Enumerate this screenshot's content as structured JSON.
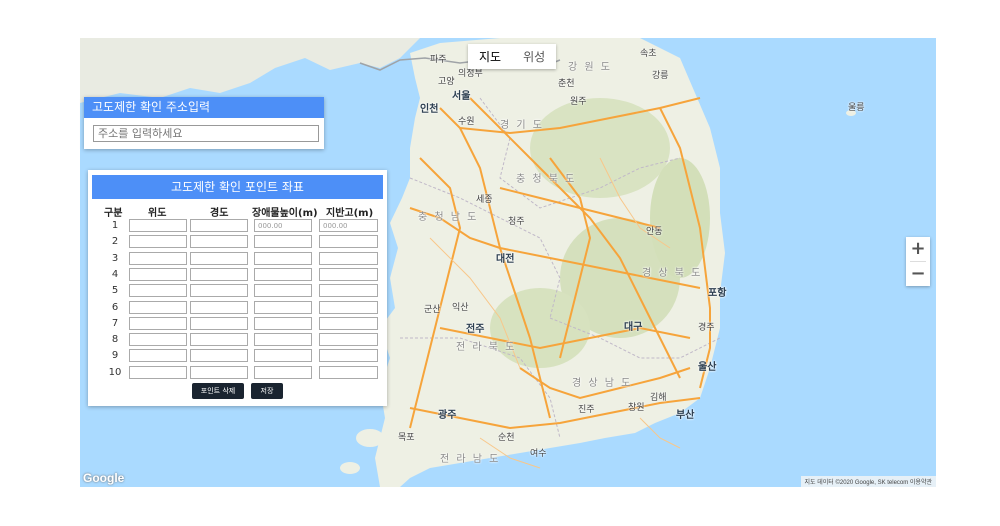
{
  "map": {
    "type_tabs": [
      {
        "label": "지도",
        "active": true
      },
      {
        "label": "위성",
        "active": false
      }
    ],
    "zoom_in": "+",
    "zoom_out": "−",
    "google_logo": "Google",
    "attribution": "지도 데이터 ©2020 Google, SK telecom 이용약관",
    "labels": {
      "seoul": "서울",
      "incheon": "인천",
      "suwon": "수원",
      "goyang": "고양",
      "uijeongbu": "의정부",
      "paju": "파주",
      "gangwon": "강 원 도",
      "chuncheon": "춘천",
      "gangneung": "강릉",
      "wonju": "원주",
      "sokcho": "속초",
      "gyeonggi": "경 기 도",
      "chungbuk": "충 청 북 도",
      "chungnam": "충 청 남 도",
      "daejeon": "대전",
      "cheongju": "청주",
      "sejong": "세종",
      "gyeongbuk": "경 상 북 도",
      "andong": "안동",
      "pohang": "포항",
      "daegu": "대구",
      "gyeongju": "경주",
      "ulsan": "울산",
      "gyeongnam": "경 상 남 도",
      "changwon": "창원",
      "busan": "부산",
      "gimhae": "김해",
      "jinju": "진주",
      "jeonbuk": "전 라 북 도",
      "jeonju": "전주",
      "gunsan": "군산",
      "iksan": "익산",
      "jeonnam": "전 라 남 도",
      "gwangju": "광주",
      "suncheon": "순천",
      "yeosu": "여수",
      "mokpo": "목포",
      "ulleung": "울릉"
    },
    "colors": {
      "sea": "#aadaff",
      "land": "#eef0e4",
      "forest": "#c8d9a6",
      "road": "#f6a43b",
      "border": "#9fa3a7"
    }
  },
  "address_panel": {
    "title": "고도제한 확인 주소입력",
    "placeholder": "주소를 입력하세요"
  },
  "points_panel": {
    "title": "고도제한 확인 포인트 좌표",
    "headers": [
      "구분",
      "위도",
      "경도",
      "장애물높이(m)",
      "지반고(m)"
    ],
    "rows": [
      {
        "no": "1",
        "lat": "",
        "lng": "",
        "obstacle": "000.00",
        "ground": "000.00"
      },
      {
        "no": "2",
        "lat": "",
        "lng": "",
        "obstacle": "",
        "ground": ""
      },
      {
        "no": "3",
        "lat": "",
        "lng": "",
        "obstacle": "",
        "ground": ""
      },
      {
        "no": "4",
        "lat": "",
        "lng": "",
        "obstacle": "",
        "ground": ""
      },
      {
        "no": "5",
        "lat": "",
        "lng": "",
        "obstacle": "",
        "ground": ""
      },
      {
        "no": "6",
        "lat": "",
        "lng": "",
        "obstacle": "",
        "ground": ""
      },
      {
        "no": "7",
        "lat": "",
        "lng": "",
        "obstacle": "",
        "ground": ""
      },
      {
        "no": "8",
        "lat": "",
        "lng": "",
        "obstacle": "",
        "ground": ""
      },
      {
        "no": "9",
        "lat": "",
        "lng": "",
        "obstacle": "",
        "ground": ""
      },
      {
        "no": "10",
        "lat": "",
        "lng": "",
        "obstacle": "",
        "ground": ""
      }
    ],
    "delete_button": "포인트 삭제",
    "save_button": "저장"
  }
}
